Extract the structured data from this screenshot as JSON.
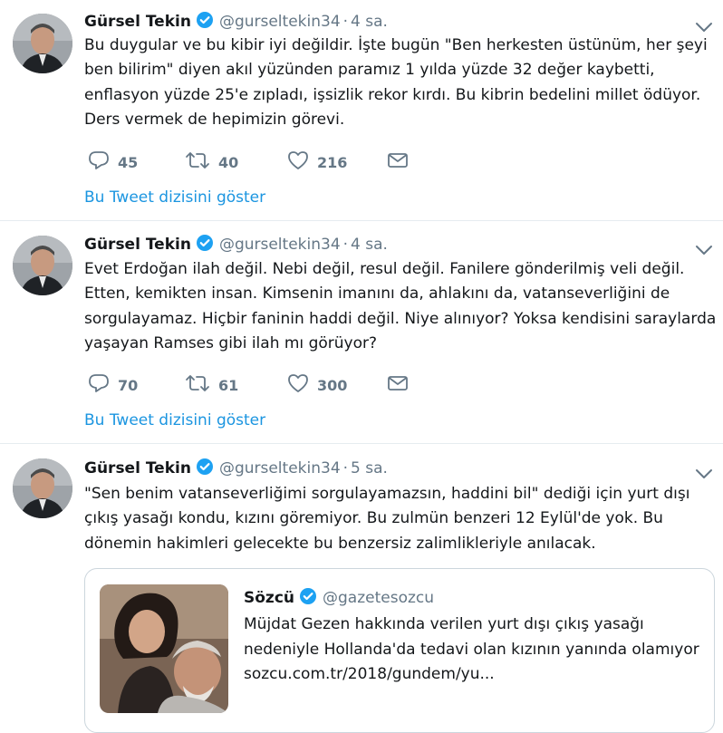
{
  "colors": {
    "accent": "#1b95e0",
    "muted": "#657786",
    "text": "#14171a",
    "divider": "#e6ecf0"
  },
  "tweets": [
    {
      "author": {
        "name": "Gürsel Tekin",
        "handle": "@gurseltekin34",
        "verified": true
      },
      "time": "4 sa.",
      "text_lines": [
        "Bu duygular ve bu kibir iyi değildir. İşte bugün \"Ben herkesten üstünüm, her şeyi",
        "ben bilirim\" diyen akıl yüzünden paramız 1 yılda yüzde 32 değer kaybetti,",
        "enflasyon yüzde 25'e zıpladı, işsizlik rekor kırdı. Bu kibrin bedelini millet ödüyor.",
        "Ders vermek de hepimizin görevi."
      ],
      "replies": "45",
      "retweets": "40",
      "likes": "216",
      "thread_link": "Bu Tweet dizisini göster"
    },
    {
      "author": {
        "name": "Gürsel Tekin",
        "handle": "@gurseltekin34",
        "verified": true
      },
      "time": "4 sa.",
      "text_lines": [
        "Evet Erdoğan ilah değil. Nebi değil, resul değil. Fanilere gönderilmiş veli değil.",
        "Etten, kemikten insan. Kimsenin imanını da, ahlakını da, vatanseverliğini de",
        "sorgulayamaz. Hiçbir faninin haddi değil. Niye alınıyor? Yoksa kendisini saraylarda",
        "yaşayan Ramses gibi ilah mı görüyor?"
      ],
      "replies": "70",
      "retweets": "61",
      "likes": "300",
      "thread_link": "Bu Tweet dizisini göster"
    },
    {
      "author": {
        "name": "Gürsel Tekin",
        "handle": "@gurseltekin34",
        "verified": true
      },
      "time": "5 sa.",
      "text_lines": [
        "\"Sen benim vatanseverliğimi sorgulayamazsın, haddini bil\" dediği için yurt dışı",
        "çıkış yasağı kondu, kızını göremiyor. Bu zulmün benzeri 12 Eylül'de yok. Bu",
        "dönemin hakimleri gelecekte bu benzersiz zalimlikleriyle anılacak."
      ],
      "quote": {
        "name": "Sözcü",
        "handle": "@gazetesozcu",
        "verified": true,
        "text_lines": [
          "Müjdat Gezen hakkında verilen yurt dışı çıkış yasağı",
          "nedeniyle Hollanda'da tedavi olan kızının yanında olamıyor",
          "sozcu.com.tr/2018/gundem/yu..."
        ]
      }
    }
  ]
}
